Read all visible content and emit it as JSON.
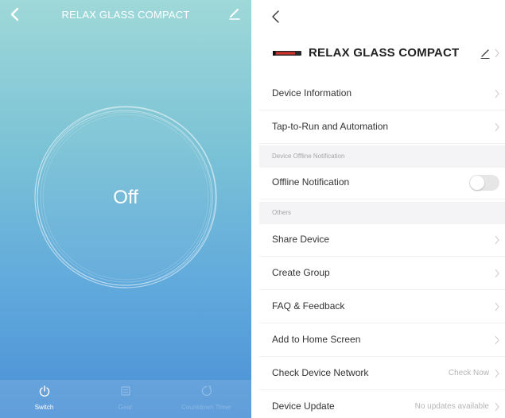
{
  "control_panel": {
    "title": "RELAX GLASS COMPACT",
    "state_text": "Off",
    "tabs": [
      {
        "label": "Switch",
        "icon": "power-icon"
      },
      {
        "label": "Gear",
        "icon": "gear-list-icon"
      },
      {
        "label": "Countdown Timer",
        "icon": "timer-icon"
      }
    ]
  },
  "settings_panel": {
    "device_name": "RELAX GLASS COMPACT",
    "rows_top": [
      {
        "label": "Device Information"
      },
      {
        "label": "Tap-to-Run and Automation"
      }
    ],
    "section_offline": "Device Offline Notification",
    "offline_row": {
      "label": "Offline Notification",
      "toggle_on": false
    },
    "section_others": "Others",
    "rows_others": [
      {
        "label": "Share Device"
      },
      {
        "label": "Create Group"
      },
      {
        "label": "FAQ & Feedback"
      },
      {
        "label": "Add to Home Screen"
      },
      {
        "label": "Check Device Network",
        "value": "Check Now"
      },
      {
        "label": "Device Update",
        "value": "No updates available"
      }
    ]
  },
  "colors": {
    "gradient_top": "#9fd8d8",
    "gradient_bottom": "#4b90d6",
    "text_primary": "#333333",
    "text_secondary": "#b5b5b5",
    "section_bg": "#f4f4f6"
  }
}
